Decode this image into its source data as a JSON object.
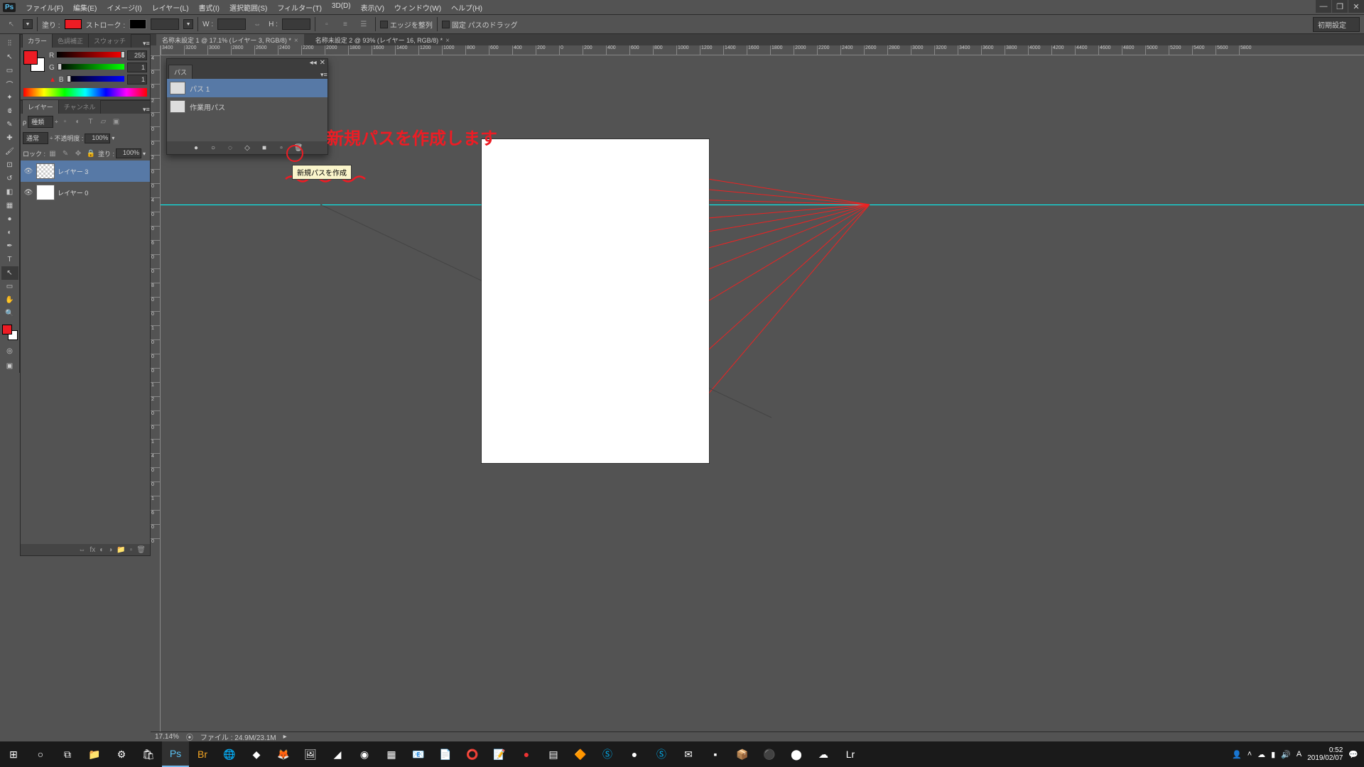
{
  "menu": [
    "ファイル(F)",
    "編集(E)",
    "イメージ(I)",
    "レイヤー(L)",
    "書式(I)",
    "選択範囲(S)",
    "フィルター(T)",
    "3D(D)",
    "表示(V)",
    "ウィンドウ(W)",
    "ヘルプ(H)"
  ],
  "options": {
    "fill_label": "塗り :",
    "stroke_label": "ストローク :",
    "w_label": "W :",
    "h_label": "H :",
    "align_edges": "エッジを整列",
    "fixed_drag": "固定 パスのドラッグ",
    "preset": "初期設定"
  },
  "doc_tabs": [
    {
      "label": "名称未設定 1 @ 17.1% (レイヤー 3, RGB/8) *",
      "active": true
    },
    {
      "label": "名称未設定 2 @ 93% (レイヤー 16, RGB/8) *",
      "active": false
    }
  ],
  "ruler_h": [
    "3400",
    "3200",
    "3000",
    "2800",
    "2600",
    "2400",
    "2200",
    "2000",
    "1800",
    "1600",
    "1400",
    "1200",
    "1000",
    "800",
    "600",
    "400",
    "200",
    "0",
    "200",
    "400",
    "600",
    "800",
    "1000",
    "1200",
    "1400",
    "1600",
    "1800",
    "2000",
    "2200",
    "2400",
    "2600",
    "2800",
    "3000",
    "3200",
    "3400",
    "3600",
    "3800",
    "4000",
    "4200",
    "4400",
    "4600",
    "4800",
    "5000",
    "5200",
    "5400",
    "5600",
    "5800"
  ],
  "ruler_v": [
    "4",
    "0",
    "0",
    "2",
    "0",
    "0",
    "0",
    "2",
    "0",
    "0",
    "4",
    "0",
    "0",
    "6",
    "0",
    "0",
    "8",
    "0",
    "0",
    "1",
    "0",
    "0",
    "0",
    "1",
    "2",
    "0",
    "0",
    "1",
    "4",
    "0",
    "0",
    "1",
    "6",
    "0",
    "0"
  ],
  "color_panel": {
    "tabs": [
      "カラー",
      "色調補正",
      "スウォッチ"
    ],
    "r": {
      "label": "R",
      "value": "255"
    },
    "g": {
      "label": "G",
      "value": "1"
    },
    "b": {
      "label": "B",
      "value": "1"
    }
  },
  "layer_panel": {
    "tabs": [
      "レイヤー",
      "チャンネル"
    ],
    "kind": "種類",
    "blend": "通常",
    "opacity_label": "不透明度 :",
    "opacity": "100%",
    "lock_label": "ロック :",
    "fill_label": "塗り :",
    "fill": "100%",
    "layers": [
      {
        "name": "レイヤー 3",
        "selected": true,
        "trans": true
      },
      {
        "name": "レイヤー 0",
        "selected": false,
        "trans": false
      }
    ]
  },
  "paths_panel": {
    "tab": "パス",
    "items": [
      {
        "name": "パス 1",
        "selected": true
      },
      {
        "name": "作業用パス",
        "selected": false
      }
    ],
    "tooltip": "新規パスを作成",
    "annotation": "新規パスを作成します"
  },
  "status": {
    "zoom": "17.14%",
    "file": "ファイル : 24.9M/23.1M"
  },
  "taskbar": {
    "time": "0:52",
    "date": "2019/02/07"
  }
}
